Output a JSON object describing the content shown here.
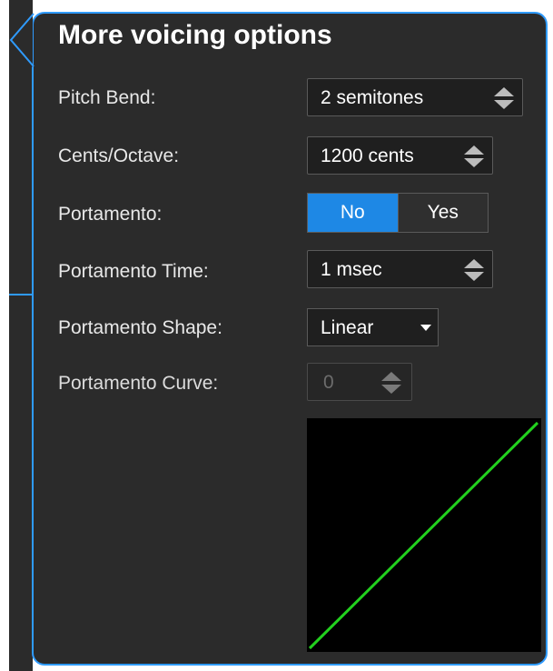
{
  "panel": {
    "title": "More voicing options"
  },
  "rows": {
    "pitch_bend": {
      "label": "Pitch Bend:",
      "value": "2 semitones"
    },
    "cents_octave": {
      "label": "Cents/Octave:",
      "value": "1200 cents"
    },
    "portamento": {
      "label": "Portamento:",
      "options": [
        "No",
        "Yes"
      ],
      "selected": "No"
    },
    "portamento_time": {
      "label": "Portamento Time:",
      "value": "1 msec"
    },
    "portamento_shape": {
      "label": "Portamento Shape:",
      "value": "Linear"
    },
    "portamento_curve": {
      "label": "Portamento Curve:",
      "value": "0",
      "enabled": false
    }
  },
  "curve_graph": {
    "curve_color": "#22d11e",
    "shape": "linear"
  },
  "colors": {
    "accent": "#2f9bff",
    "toggle_on": "#1e88e5",
    "panel_bg": "#2b2b2b"
  },
  "icons": {
    "stepper": "up-down-arrows-icon",
    "dropdown": "caret-down-icon"
  }
}
